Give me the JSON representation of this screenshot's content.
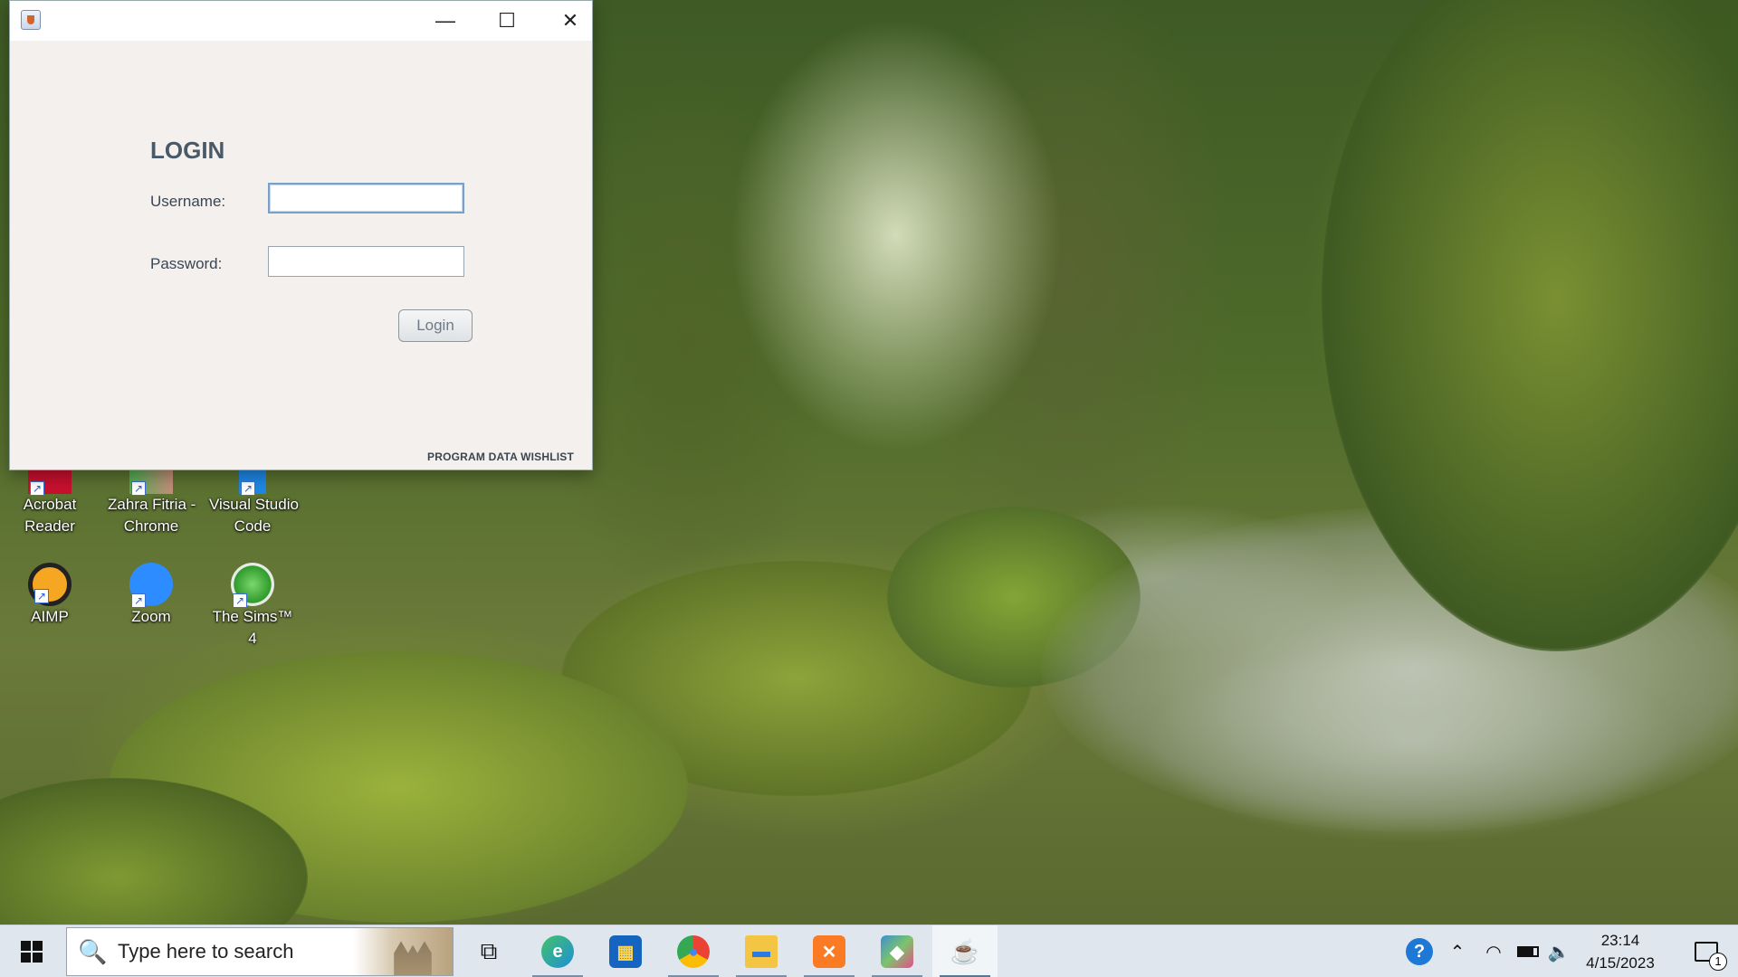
{
  "window": {
    "heading": "LOGIN",
    "username_label": "Username:",
    "password_label": "Password:",
    "username_value": "",
    "password_value": "",
    "login_button": "Login",
    "footer": "PROGRAM DATA WISHLIST",
    "controls": {
      "minimize": "—",
      "maximize": "☐",
      "close": "✕"
    }
  },
  "desktop_icons": [
    {
      "label": "Acrobat\nReader",
      "icon": "acrobat-reader-icon",
      "color": "#c8102e"
    },
    {
      "label": "Zahra Fitria -\nChrome",
      "icon": "chrome-profile-icon",
      "color": "#4caf50"
    },
    {
      "label": "Visual Studio\nCode",
      "icon": "vscode-icon",
      "color": "#1e88e5"
    },
    {
      "label": "AIMP",
      "icon": "aimp-icon",
      "color": "#f5a623"
    },
    {
      "label": "Zoom",
      "icon": "zoom-icon",
      "color": "#2d8cff"
    },
    {
      "label": "The Sims™ 4",
      "icon": "sims-icon",
      "color": "#44b03a"
    }
  ],
  "taskbar": {
    "search_placeholder": "Type here to search",
    "search_icon": "🔍",
    "apps": [
      {
        "name": "task-view",
        "icon": "task-view-icon",
        "glyph": "⧉",
        "color": "#dfe6ee",
        "fg": "#111"
      },
      {
        "name": "edge",
        "icon": "edge-icon",
        "glyph": "e",
        "color": "#1f8fd6",
        "fg": "#fff"
      },
      {
        "name": "store",
        "icon": "microsoft-store-icon",
        "glyph": "▦",
        "color": "#1565c0",
        "fg": "#ffd54f"
      },
      {
        "name": "chrome",
        "icon": "chrome-icon",
        "glyph": "●",
        "color": "#ea4335",
        "fg": "#fbbc05"
      },
      {
        "name": "file-explorer",
        "icon": "folder-icon",
        "glyph": "▬",
        "color": "#f4c542",
        "fg": "#2c7be5"
      },
      {
        "name": "xampp",
        "icon": "xampp-icon",
        "glyph": "✕",
        "color": "#fb7a24",
        "fg": "#fff"
      },
      {
        "name": "virtualbox",
        "icon": "virtualbox-icon",
        "glyph": "◆",
        "color": "#3d8fd1",
        "fg": "#fff"
      },
      {
        "name": "java",
        "icon": "java-icon",
        "glyph": "☕",
        "color": "#f2f5f8",
        "fg": "#d3652a"
      }
    ],
    "clock_time": "23:14",
    "clock_date": "4/15/2023",
    "notification_count": "1",
    "tray_icons": [
      "help-icon",
      "chevron-up-icon",
      "wifi-icon",
      "battery-icon",
      "volume-icon"
    ]
  }
}
